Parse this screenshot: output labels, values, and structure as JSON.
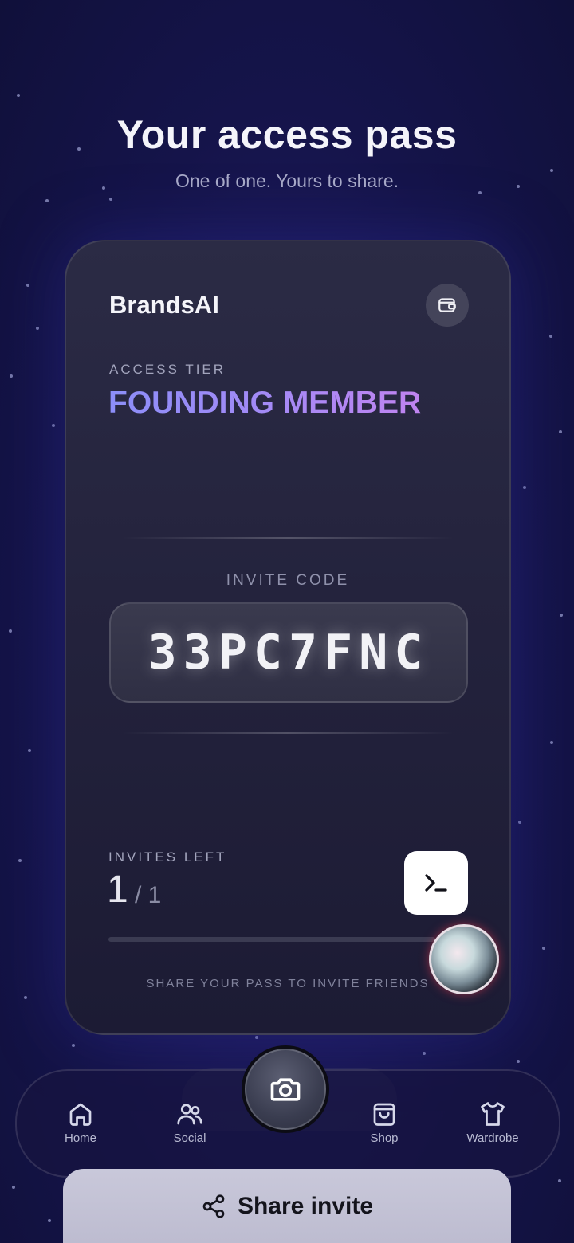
{
  "header": {
    "title": "Your access pass",
    "subtitle": "One of one. Yours to share."
  },
  "card": {
    "brand": "BrandsAI",
    "wallet_icon": "wallet-icon",
    "tier_label": "ACCESS TIER",
    "tier_value": "FOUNDING MEMBER",
    "code_label": "INVITE CODE",
    "code_value": "33PC7FNC",
    "invites_label": "INVITES LEFT",
    "invites_left": "1",
    "invites_total": "/ 1",
    "invites_progress": 0.0,
    "terminal_icon": "terminal-icon",
    "share_hint": "SHARE YOUR PASS TO INVITE FRIENDS"
  },
  "nav": {
    "items": [
      {
        "label": "Home",
        "icon": "home-icon"
      },
      {
        "label": "Social",
        "icon": "users-icon"
      },
      {
        "label": "Shop",
        "icon": "shopping-bag-icon"
      },
      {
        "label": "Wardrobe",
        "icon": "shirt-icon"
      }
    ],
    "camera_icon": "camera-icon"
  },
  "share_button": {
    "label": "Share invite",
    "icon": "share-icon"
  },
  "colors": {
    "tier_gradient_start": "#8c8ef8",
    "tier_gradient_end": "#c084f0",
    "background": "#1d1a5c"
  }
}
